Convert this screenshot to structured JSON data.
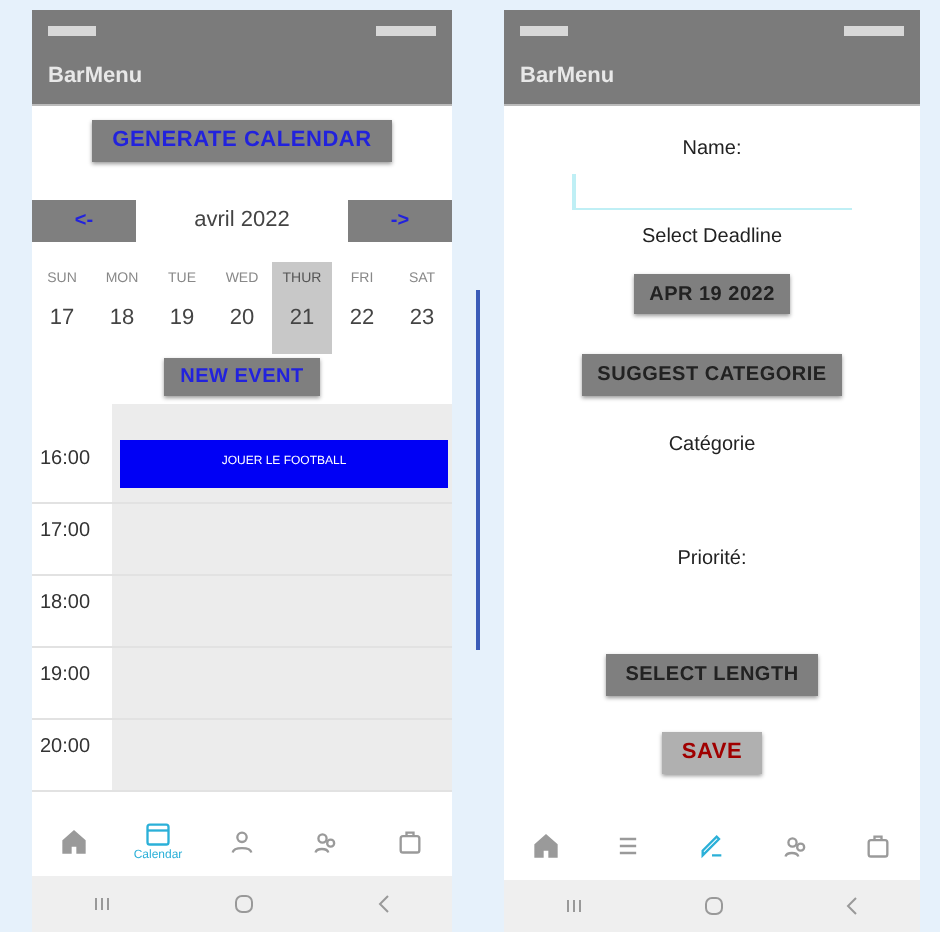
{
  "calendar_screen": {
    "app_title": "BarMenu",
    "generate_button": "GENERATE CALENDAR",
    "prev_button": "<-",
    "month": "avril 2022",
    "next_button": "->",
    "days": [
      {
        "weekday": "SUN",
        "date": "17",
        "selected": false
      },
      {
        "weekday": "MON",
        "date": "18",
        "selected": false
      },
      {
        "weekday": "TUE",
        "date": "19",
        "selected": false
      },
      {
        "weekday": "WED",
        "date": "20",
        "selected": false
      },
      {
        "weekday": "THUR",
        "date": "21",
        "selected": true
      },
      {
        "weekday": "FRI",
        "date": "22",
        "selected": false
      },
      {
        "weekday": "SAT",
        "date": "23",
        "selected": false
      }
    ],
    "new_event_button": "NEW EVENT",
    "hours": [
      {
        "time": "16:00",
        "event": "JOUER LE FOOTBALL"
      },
      {
        "time": "17:00"
      },
      {
        "time": "18:00"
      },
      {
        "time": "19:00"
      },
      {
        "time": "20:00"
      }
    ],
    "nav": [
      {
        "kind": "home",
        "selected": false
      },
      {
        "kind": "calendar",
        "selected": true,
        "label": "Calendar"
      },
      {
        "kind": "person",
        "selected": false
      },
      {
        "kind": "group",
        "selected": false
      },
      {
        "kind": "bag",
        "selected": false
      }
    ]
  },
  "task_screen": {
    "app_title": "BarMenu",
    "name_label": "Name:",
    "deadline_label": "Select Deadline",
    "date_button": "APR 19 2022",
    "suggest_button": "SUGGEST CATEGORIE",
    "category_label": "Catégorie",
    "priority_label": "Priorité:",
    "length_button": "SELECT LENGTH",
    "save_button": "SAVE",
    "nav": [
      {
        "kind": "home",
        "selected": false
      },
      {
        "kind": "list",
        "selected": false
      },
      {
        "kind": "edit",
        "selected": true
      },
      {
        "kind": "group",
        "selected": false
      },
      {
        "kind": "bag",
        "selected": false
      }
    ]
  }
}
